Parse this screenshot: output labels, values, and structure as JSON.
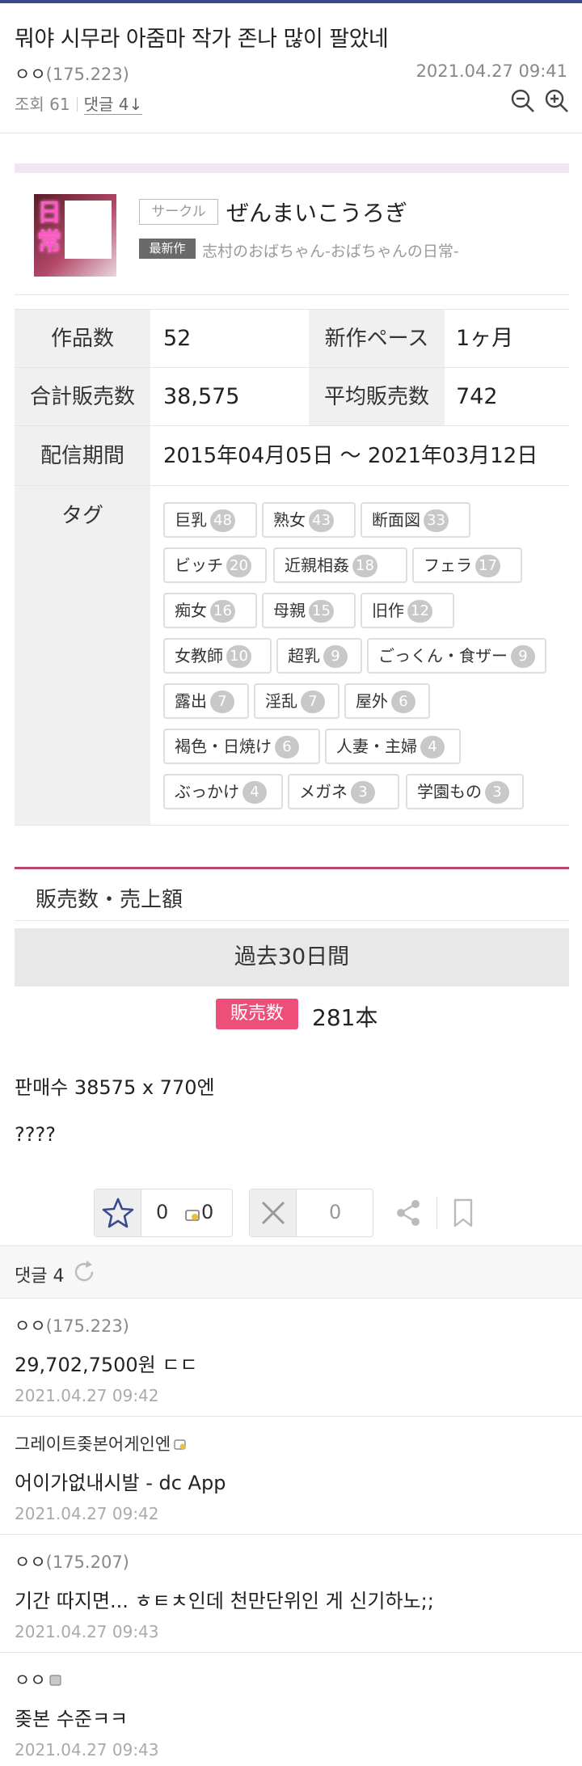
{
  "post": {
    "title": "뭐야 시무라 아줌마 작가 존나 많이 팔았네",
    "author": "ㅇㅇ",
    "author_ip": "(175.223)",
    "date": "2021.04.27 09:41",
    "views_label": "조회 61",
    "comments_label": "댓글 4↓"
  },
  "embed": {
    "thumb_kanji": "日常",
    "circle_badge": "サークル",
    "circle_name": "ぜんまいこうろぎ",
    "new_badge": "最新作",
    "new_title": "志村のおばちゃん-おばちゃんの日常-",
    "table": {
      "works_label": "作品数",
      "works_value": "52",
      "pace_label": "新作ペース",
      "pace_value": "1ヶ月",
      "total_label": "合計販売数",
      "total_value": "38,575",
      "avg_label": "平均販売数",
      "avg_value": "742",
      "period_label": "配信期間",
      "period_value": "2015年04月05日 〜 2021年03月12日",
      "tags_label": "タグ"
    },
    "tags": [
      {
        "name": "巨乳",
        "count": "48"
      },
      {
        "name": "熟女",
        "count": "43"
      },
      {
        "name": "断面図",
        "count": "33"
      },
      {
        "name": "ビッチ",
        "count": "20"
      },
      {
        "name": "近親相姦",
        "count": "18"
      },
      {
        "name": "フェラ",
        "count": "17"
      },
      {
        "name": "痴女",
        "count": "16"
      },
      {
        "name": "母親",
        "count": "15"
      },
      {
        "name": "旧作",
        "count": "12"
      },
      {
        "name": "女教師",
        "count": "10"
      },
      {
        "name": "超乳",
        "count": "9"
      },
      {
        "name": "ごっくん・食ザー",
        "count": "9"
      },
      {
        "name": "露出",
        "count": "7"
      },
      {
        "name": "淫乱",
        "count": "7"
      },
      {
        "name": "屋外",
        "count": "6"
      },
      {
        "name": "褐色・日焼け",
        "count": "6"
      },
      {
        "name": "人妻・主婦",
        "count": "4"
      },
      {
        "name": "ぶっかけ",
        "count": "4"
      },
      {
        "name": "メガネ",
        "count": "3"
      },
      {
        "name": "学園もの",
        "count": "3"
      }
    ],
    "sales_title": "販売数・売上額",
    "period_button": "過去30日間",
    "sales_badge": "販売数",
    "sales_value": "281本"
  },
  "body": {
    "line1": "판매수 38575 x 770엔",
    "line2": "????"
  },
  "recommend": {
    "up_count": "0",
    "fix_count": "0",
    "down_count": "0"
  },
  "comments_header": "댓글 4",
  "comments": [
    {
      "author": "ㅇㅇ",
      "ip": "(175.223)",
      "text": "29,702,7500원 ㄷㄷ",
      "date": "2021.04.27 09:42"
    },
    {
      "author": "그레이트좆본어게인엔",
      "ip": "",
      "text": "어이가없내시발 - dc App",
      "date": "2021.04.27 09:42"
    },
    {
      "author": "ㅇㅇ",
      "ip": "(175.207)",
      "text": "기간 따지면... ㅎㅌㅊ인데 천만단위인 게 신기하노;;",
      "date": "2021.04.27 09:43"
    },
    {
      "author": "ㅇㅇ",
      "ip": "",
      "text": "좆본 수준ㅋㅋ",
      "date": "2021.04.27 09:43"
    }
  ],
  "colors": {
    "top_bar": "#3b4890",
    "sales_accent": "#b8476a",
    "sales_badge": "#ee4f7a",
    "pink_strip": "#f4e4ef"
  }
}
